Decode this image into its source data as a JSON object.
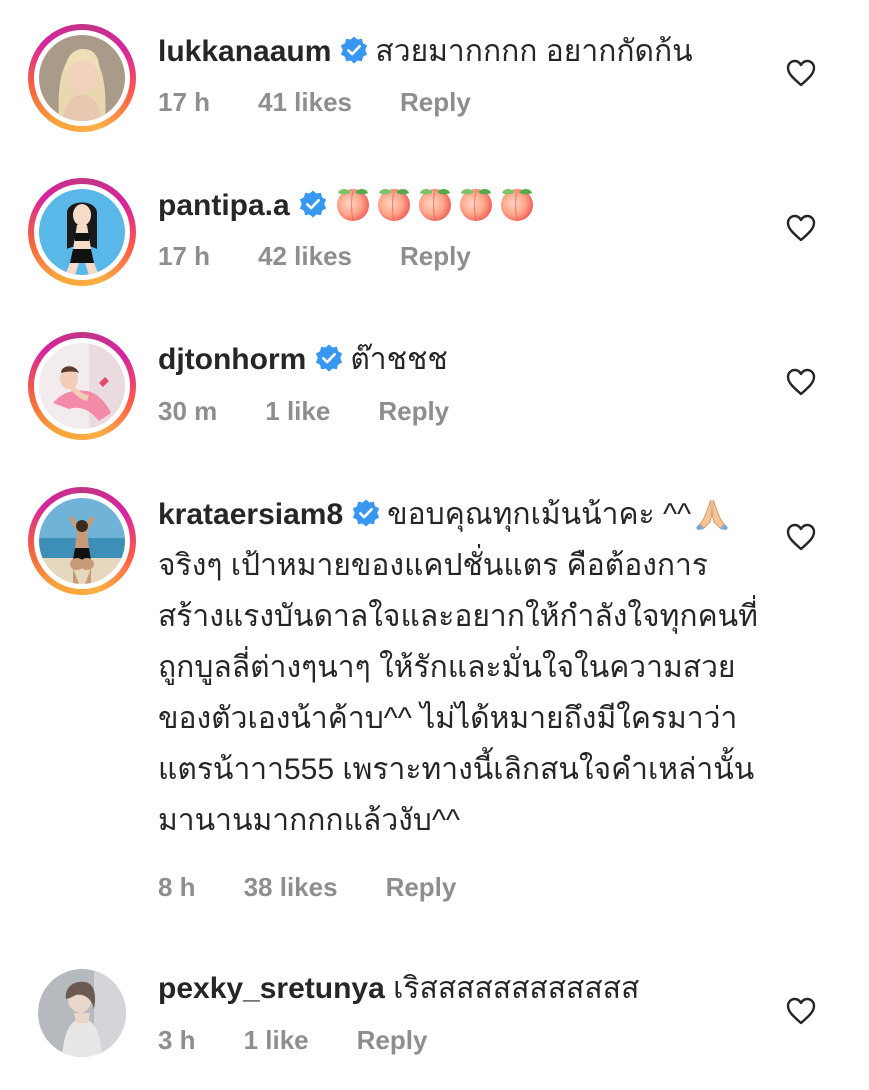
{
  "comments": [
    {
      "username": "lukkanaaum",
      "verified": true,
      "text": "สวยมากกกก อยากกัดก้น",
      "time": "17 h",
      "likes": "41 likes",
      "reply": "Reply",
      "avatar_icon": "avatar-photo-woman-blonde"
    },
    {
      "username": "pantipa.a",
      "verified": true,
      "text": "",
      "emoji": [
        "peach-emoji",
        "peach-emoji",
        "peach-emoji",
        "peach-emoji",
        "peach-emoji"
      ],
      "time": "17 h",
      "likes": "42 likes",
      "reply": "Reply",
      "avatar_icon": "avatar-illustration-woman"
    },
    {
      "username": "djtonhorm",
      "verified": true,
      "text": "ต๊าชชช",
      "time": "30 m",
      "likes": "1 like",
      "reply": "Reply",
      "avatar_icon": "avatar-photo-woman-pink"
    },
    {
      "username": "krataersiam8",
      "verified": true,
      "text_part1": "ขอบคุณทุกเม้นน้าคะ ^^",
      "text_part2": "จริงๆ เป้าหมายของแคปชั่นแตร คือต้องการสร้างแรงบันดาลใจและอยากให้กำลังใจทุกคนที่ถูกบูลลี่ต่างๆนาๆ ให้รักและมั่นใจในความสวยของตัวเองน้าค้าบ^^ ไม่ได้หมายถึงมีใครมาว่าแตรน้าาา555 เพราะทางนี้เลิกสนใจคำเหล่านั้นมานานมากกกแล้วงับ^^",
      "time": "8 h",
      "likes": "38 likes",
      "reply": "Reply",
      "avatar_icon": "avatar-photo-beach"
    },
    {
      "username": "pexky_sretunya",
      "verified": false,
      "text": "เริสสสสสสสสสสสส",
      "time": "3 h",
      "likes": "1 like",
      "reply": "Reply",
      "avatar_icon": "avatar-photo-gray"
    }
  ],
  "colors": {
    "text": "#262626",
    "meta": "#8e8e8e",
    "verified_blue": "#3897f0",
    "story_ring": "#d6249f"
  }
}
